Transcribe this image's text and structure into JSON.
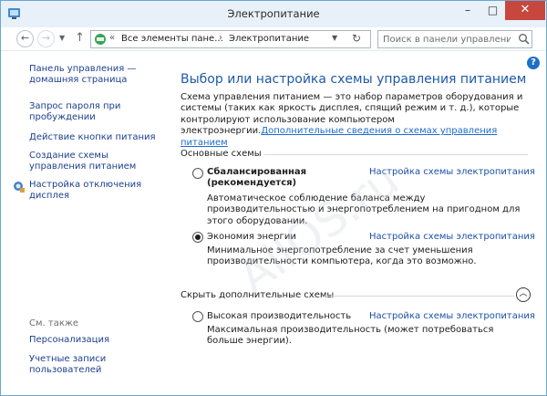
{
  "window": {
    "title": "Электропитание"
  },
  "nav": {
    "address": {
      "crumb_sep_1": "«",
      "crumb_1": "Все элементы пане...",
      "crumb_sep_2": "›",
      "crumb_2": "Электропитание"
    },
    "search": {
      "placeholder": "Поиск в панели управления"
    }
  },
  "sidebar": {
    "home_label": "Панель управления — домашняя страница",
    "items": [
      "Запрос пароля при пробуждении",
      "Действие кнопки питания",
      "Создание схемы управления питанием",
      "Настройка отключения дисплея"
    ],
    "see_also_label": "См. также",
    "see_also_items": [
      "Персонализация",
      "Учетные записи пользователей"
    ]
  },
  "main": {
    "title": "Выбор или настройка схемы управления питанием",
    "description": "Схема управления питанием — это набор параметров оборудования и системы (таких как яркость дисплея, спящий режим и т. д.), которые контролируют использование компьютером электроэнергии.",
    "more_info_link": "Дополнительные сведения о схемах управления питанием",
    "basic_section_label": "Основные схемы",
    "hidden_section_label": "Скрыть дополнительные схемы",
    "plan_settings_link": "Настройка схемы электропитания",
    "plans": [
      {
        "name": "Сбалансированная (рекомендуется)",
        "selected": false,
        "description": "Автоматическое соблюдение баланса между производительностью и энергопотреблением на пригодном для этого оборудовании."
      },
      {
        "name": "Экономия энергии",
        "selected": true,
        "description": "Минимальное энергопотребление за счет уменьшения производительности компьютера, когда это возможно."
      }
    ],
    "hidden_plans": [
      {
        "name": "Высокая производительность",
        "selected": false,
        "description": "Максимальная производительность (может потребоваться больше энергии)."
      }
    ]
  },
  "watermark": "AllOS.ru"
}
